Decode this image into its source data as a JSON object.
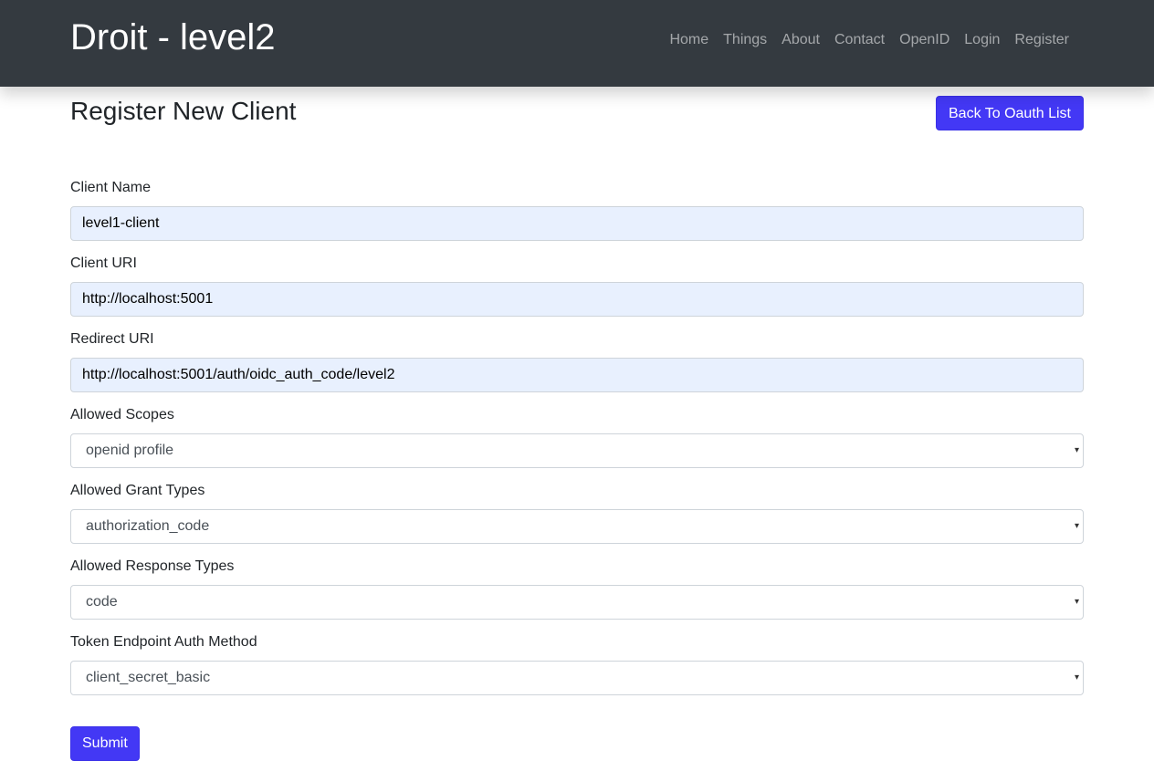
{
  "navbar": {
    "brand": "Droit - level2",
    "links": [
      "Home",
      "Things",
      "About",
      "Contact",
      "OpenID",
      "Login",
      "Register"
    ]
  },
  "page": {
    "title": "Register New Client",
    "back_button": "Back To Oauth List"
  },
  "form": {
    "client_name": {
      "label": "Client Name",
      "value": "level1-client"
    },
    "client_uri": {
      "label": "Client URI",
      "value": "http://localhost:5001"
    },
    "redirect_uri": {
      "label": "Redirect URI",
      "value": "http://localhost:5001/auth/oidc_auth_code/level2"
    },
    "allowed_scopes": {
      "label": "Allowed Scopes",
      "selected": "openid profile"
    },
    "allowed_grant_types": {
      "label": "Allowed Grant Types",
      "selected": "authorization_code"
    },
    "allowed_response_types": {
      "label": "Allowed Response Types",
      "selected": "code"
    },
    "token_endpoint_auth_method": {
      "label": "Token Endpoint Auth Method",
      "selected": "client_secret_basic"
    },
    "submit_label": "Submit"
  },
  "icons": {
    "select_caret": "chevron-down-icon"
  },
  "colors": {
    "navbar_bg": "#343a40",
    "primary_button": "#4338f5",
    "autofill_input_bg": "#e8f0fe"
  }
}
